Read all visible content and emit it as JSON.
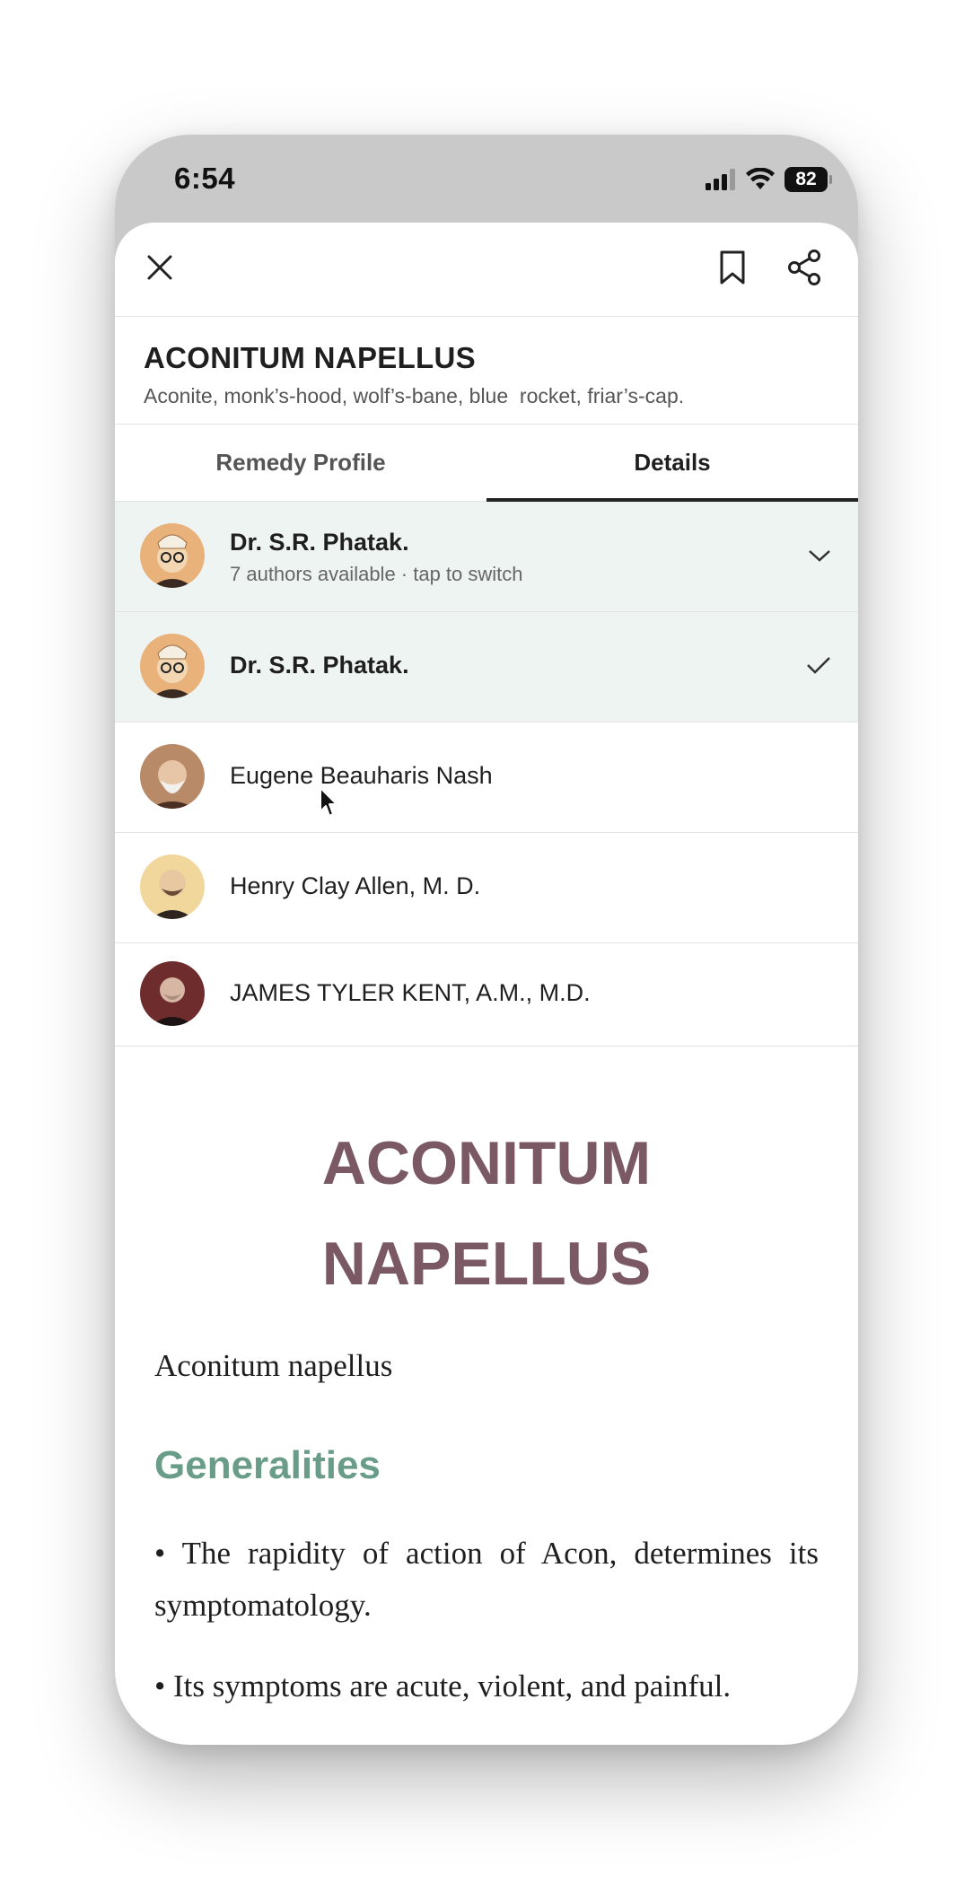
{
  "status_bar": {
    "time": "6:54",
    "battery": "82"
  },
  "toolbar": {
    "close": "close",
    "bookmark": "bookmark",
    "share": "share"
  },
  "remedy": {
    "title": "ACONITUM NAPELLUS",
    "aliases": "Aconite, monk’s-hood, wolf’s-bane, blue  rocket, friar’s-cap."
  },
  "tabs": [
    {
      "label": "Remedy Profile",
      "active": false
    },
    {
      "label": "Details",
      "active": true
    }
  ],
  "author_selector": {
    "current": "Dr. S.R. Phatak.",
    "hint": "7 authors available · tap to switch"
  },
  "authors": [
    {
      "name": "Dr. S.R. Phatak.",
      "selected": true
    },
    {
      "name": "Eugene Beauharis Nash",
      "selected": false
    },
    {
      "name": "Henry Clay Allen, M. D.",
      "selected": false
    },
    {
      "name": "JAMES TYLER KENT, A.M., M.D.",
      "selected": false
    }
  ],
  "article": {
    "title_line1": "ACONITUM",
    "title_line2": "NAPELLUS",
    "latin_name": "Aconitum napellus",
    "section": "Generalities",
    "paragraphs": [
      "• The rapidity of action of Acon, determines its symptomatology.",
      "• Its symptoms are acute, violent, and painful."
    ]
  },
  "colors": {
    "title": "#7a5864",
    "section": "#6a9d89",
    "selected_row": "#eef4f2"
  }
}
